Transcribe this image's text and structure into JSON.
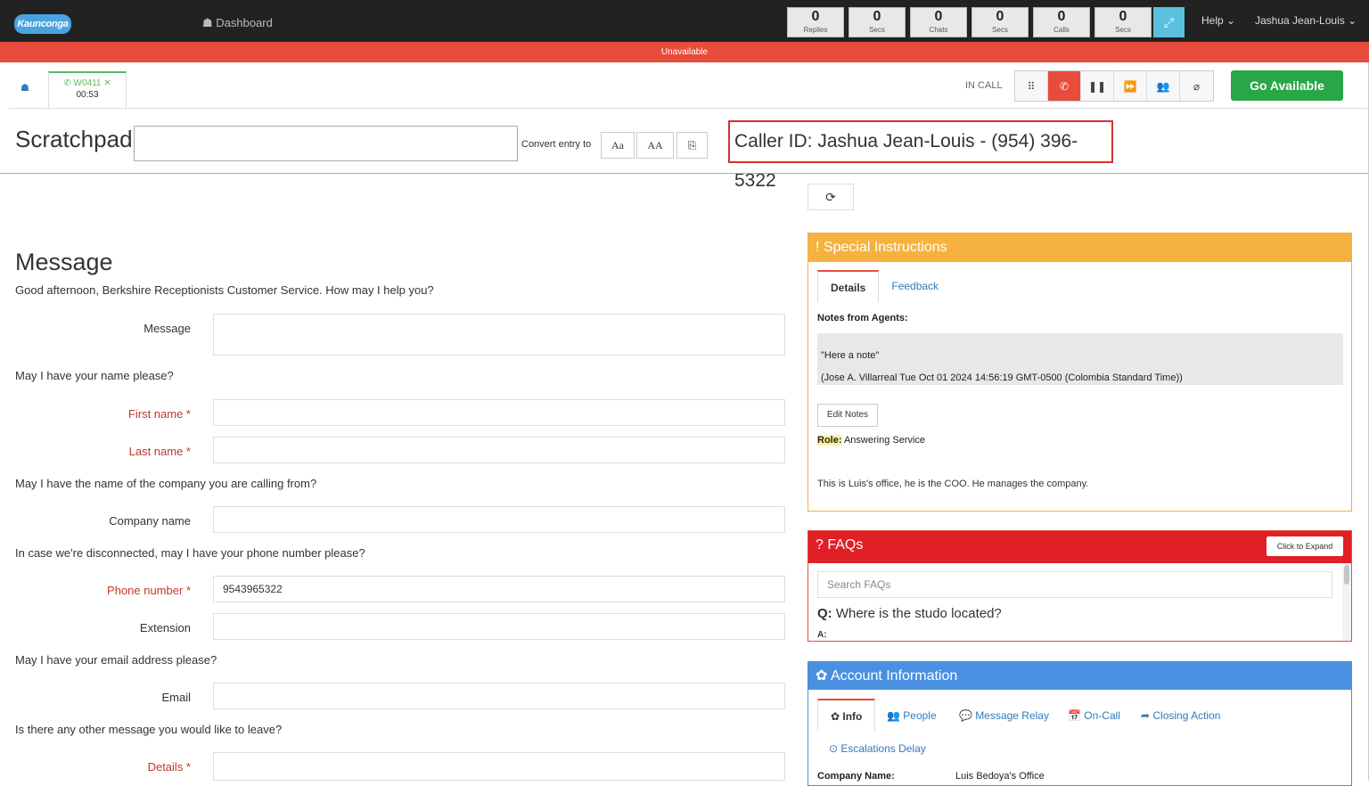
{
  "topbar": {
    "logo": "Kaunconga",
    "nav_dashboard": "☗ Dashboard",
    "counters": [
      {
        "value": "0",
        "label": "Replies"
      },
      {
        "value": "0",
        "label": "Secs"
      },
      {
        "value": "0",
        "label": "Chats"
      },
      {
        "value": "0",
        "label": "Secs"
      },
      {
        "value": "0",
        "label": "Calls"
      },
      {
        "value": "0",
        "label": "Secs"
      }
    ],
    "help": "Help ⌄",
    "user": "Jashua Jean-Louis ⌄"
  },
  "status": {
    "text": "Unavailable",
    "color": "#e74c3c"
  },
  "call_tab": {
    "id": "W0411 ✕",
    "timer": "00:53"
  },
  "call_state": "IN CALL",
  "go_available": "Go Available",
  "scratchpad": {
    "title": "Scratchpad",
    "convert_label": "Convert entry to",
    "btn_aa": "Aa",
    "btn_AA": "AA"
  },
  "caller_id": "Caller ID: Jashua Jean-Louis - (954) 396-5322",
  "message": {
    "title": "Message",
    "greeting": "Good afternoon, Berkshire Receptionists Customer Service. How may I help you?",
    "q_name": "May I have your name please?",
    "q_company": "May I have the name of the company you are calling from?",
    "q_phone": "In case we're disconnected, may I have your phone number please?",
    "q_email": "May I have your email address please?",
    "q_other": "Is there any other message you would like to leave?",
    "labels": {
      "message": "Message",
      "first_name": "First name *",
      "last_name": "Last name *",
      "company_name": "Company name",
      "phone_number": "Phone number *",
      "extension": "Extension",
      "email": "Email",
      "details": "Details *"
    },
    "phone_value": "9543965322"
  },
  "special": {
    "title": "! Special Instructions",
    "tab_details": "Details",
    "tab_feedback": "Feedback",
    "notes_heading": "Notes from Agents:",
    "note_line1": "\"Here a note\"",
    "note_line2": "(Jose A. Villarreal Tue Oct 01 2024 14:56:19 GMT-0500 (Colombia Standard Time))",
    "edit_notes": "Edit Notes",
    "role_label": "Role:",
    "role_value": " Answering Service",
    "description": "This is Luis's office, he is the COO. He manages the company."
  },
  "faqs": {
    "title": "? FAQs",
    "click_expand": "Click to Expand",
    "search_placeholder": "Search FAQs",
    "q_label": "Q:",
    "question": " Where is the studo located?",
    "a_label": "A:"
  },
  "account": {
    "title": "✿ Account Information",
    "tabs": [
      "✿ Info",
      "👥 People",
      "💬 Message Relay",
      "📅 On-Call",
      "➦ Closing Action",
      "⊙ Escalations Delay"
    ],
    "company_label": "Company Name:",
    "company_value": "Luis Bedoya's Office"
  }
}
